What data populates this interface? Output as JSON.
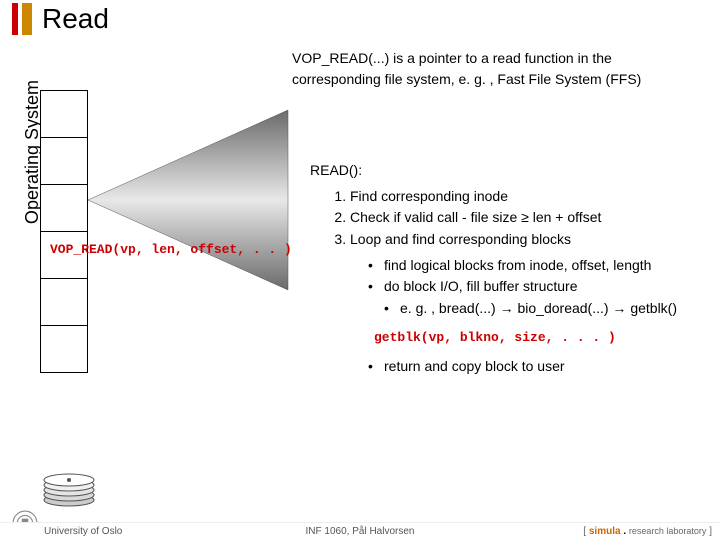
{
  "title": "Read",
  "os_label": "Operating System",
  "vop_call": "VOP_READ(vp, len, offset, . . )",
  "description_line1": "VOP_READ(...) is a pointer to a read function in the",
  "description_line2": "corresponding file system, e. g. , Fast File System (FFS)",
  "read_header": "READ():",
  "steps": {
    "1": "Find corresponding inode",
    "2": "Check if valid call - file size ≥ len + offset",
    "3": "Loop and find corresponding blocks"
  },
  "bullets": {
    "0": "find logical blocks from inode, offset, length",
    "1": "do block I/O, fill buffer structure",
    "2": "e. g. , bread(...) → bio_doread(...) → getblk()"
  },
  "getblk": "getblk(vp, blkno, size, . . . )",
  "lastbullet": "return and copy block to user",
  "footer": {
    "left": "University of Oslo",
    "center": "INF 1060, Pål Halvorsen",
    "right": {
      "open": "[ ",
      "brand1": "simula",
      "dot": " . ",
      "brand2": "research laboratory",
      "close": " ]"
    }
  }
}
